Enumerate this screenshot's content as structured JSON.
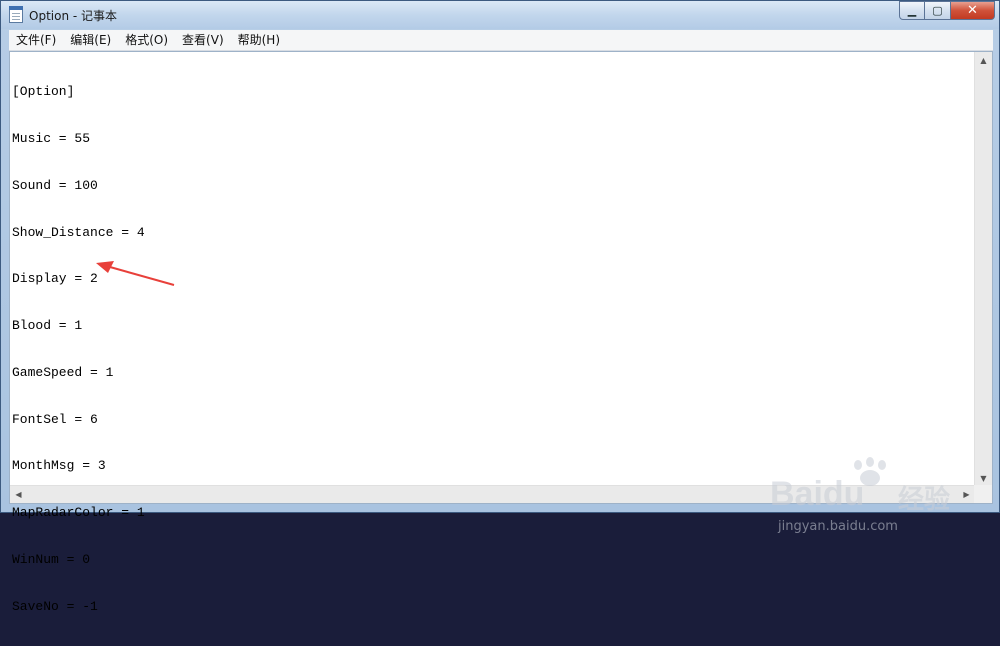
{
  "window": {
    "title": "Option - 记事本",
    "faint_tabs": [
      "",
      "",
      ""
    ]
  },
  "menu": [
    {
      "label": "文件(F)"
    },
    {
      "label": "编辑(E)"
    },
    {
      "label": "格式(O)"
    },
    {
      "label": "查看(V)"
    },
    {
      "label": "帮助(H)"
    }
  ],
  "content": {
    "lines": [
      "[Option]",
      "Music = 55",
      "Sound = 100",
      "Show_Distance = 4",
      "Display = 2",
      "Blood = 1",
      "GameSpeed = 1",
      "FontSel = 6",
      "MonthMsg = 3",
      "MapRadarColor = 1",
      "WinNum = 0",
      "SaveNo = -1"
    ]
  },
  "annotation": {
    "color": "#e8403a"
  },
  "watermark": {
    "main": "Baidu",
    "cn": "经验",
    "url": "jingyan.baidu.com"
  },
  "colors": {
    "close_button": "#c23a22",
    "accent": "#3d6fb0"
  }
}
